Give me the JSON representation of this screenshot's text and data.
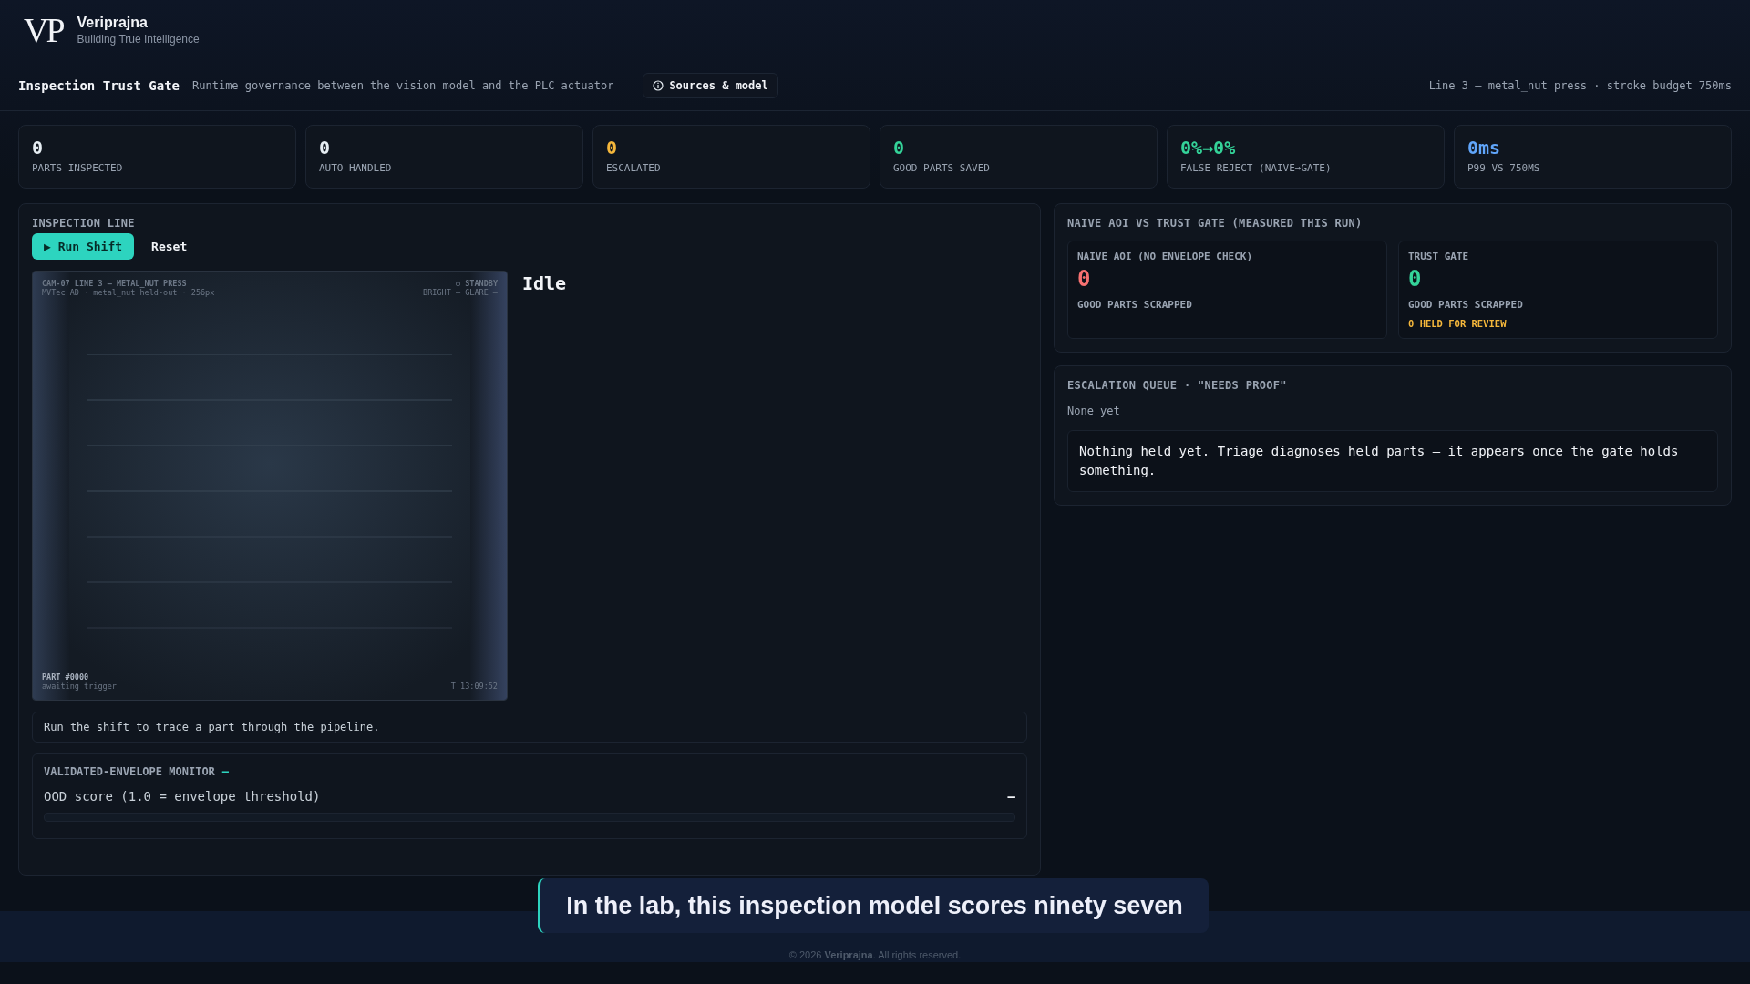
{
  "brand": {
    "logo": "VP",
    "name": "Veriprajna",
    "tagline": "Building True Intelligence"
  },
  "title_bar": {
    "title": "Inspection Trust Gate",
    "subtitle": "Runtime governance between the vision model and the PLC actuator",
    "sources_button": "Sources & model",
    "context": "Line 3 — metal_nut press · stroke budget 750ms"
  },
  "stats": [
    {
      "value": "0",
      "label": "PARTS INSPECTED",
      "color": "#e6edf3"
    },
    {
      "value": "0",
      "label": "AUTO-HANDLED",
      "color": "#e6edf3"
    },
    {
      "value": "0",
      "label": "ESCALATED",
      "color": "#f5b73b"
    },
    {
      "value": "0",
      "label": "GOOD PARTS SAVED",
      "color": "#34d399"
    },
    {
      "value": "0%→0%",
      "label": "FALSE-REJECT (NAIVE→GATE)",
      "color": "#34d399"
    },
    {
      "value": "0ms",
      "label": "P99 VS 750MS",
      "color": "#60a5fa"
    }
  ],
  "inspection_line": {
    "heading": "INSPECTION LINE",
    "buttons": [
      {
        "label": "▶ Run Shift",
        "kind": "primary"
      },
      {
        "label": "Reset",
        "kind": "ghost"
      }
    ],
    "camera": {
      "kind": "picture",
      "camera_id": "CAM-07  LINE 3 — METAL_NUT PRESS",
      "mode": "○ STANDBY",
      "source": "MVTec AD · metal_nut held-out · 256px",
      "readings": "BRIGHT —  GLARE —",
      "part": "PART #0000",
      "part_state": "awaiting trigger",
      "time": "T 13:09:52"
    },
    "status": "Idle",
    "message": "Run the shift to trace a part through the pipeline.",
    "monitor": {
      "heading": "VALIDATED-ENVELOPE MONITOR",
      "indicator": "—",
      "metric_label": "OOD score (1.0 = envelope threshold)",
      "metric_value": "—",
      "level": 0
    }
  },
  "comparison": {
    "heading": "NAIVE AOI VS TRUST GATE (MEASURED THIS RUN)",
    "cards": [
      {
        "title": "NAIVE AOI (NO ENVELOPE CHECK)",
        "value": "0",
        "color": "#f87171",
        "label": "GOOD PARTS SCRAPPED"
      },
      {
        "title": "TRUST GATE",
        "value": "0",
        "color": "#34d399",
        "label": "GOOD PARTS SCRAPPED",
        "note": "0 HELD FOR REVIEW"
      }
    ]
  },
  "escalation": {
    "heading": "ESCALATION QUEUE · \"NEEDS PROOF\"",
    "empty": "None yet",
    "triage": "Nothing held yet. Triage diagnoses held parts — it appears once the gate holds something."
  },
  "footer": "© 2026 **Veriprajna**. All rights reserved.",
  "caption": "In the lab, this inspection model scores ninety seven"
}
